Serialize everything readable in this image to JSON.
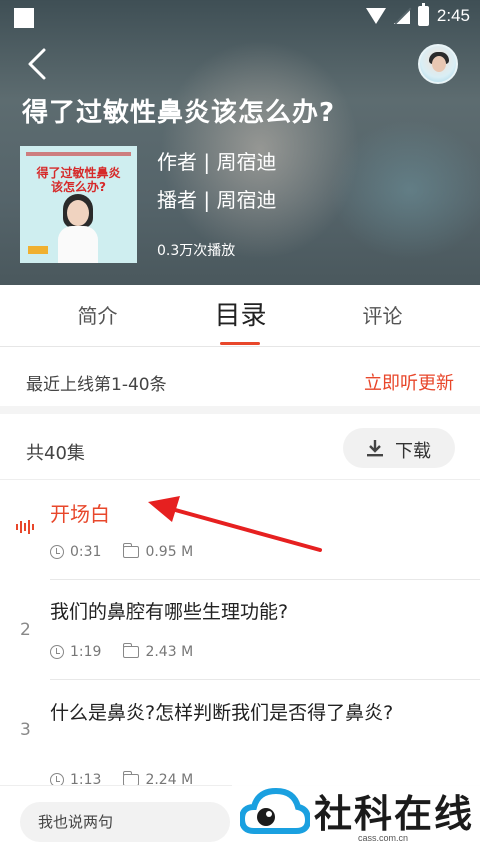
{
  "status_bar": {
    "time": "2:45"
  },
  "header": {
    "title": "得了过敏性鼻炎该怎么办?",
    "author": "作者 | 周宿迪",
    "reader": "播者 | 周宿迪",
    "plays": "0.3万次播放",
    "cover_title": [
      "得了过敏性鼻炎",
      "该怎么办?"
    ]
  },
  "tabs": [
    {
      "label": "简介",
      "active": false
    },
    {
      "label": "目录",
      "active": true
    },
    {
      "label": "评论",
      "active": false
    }
  ],
  "latest": {
    "text": "最近上线第1-40条",
    "action": "立即听更新"
  },
  "episodes_header": {
    "count": "共40集",
    "download_label": "下载"
  },
  "episodes": [
    {
      "number": "",
      "title": "开场白",
      "duration": "0:31",
      "size": "0.95 M",
      "playing": true
    },
    {
      "number": "2",
      "title": "我们的鼻腔有哪些生理功能?",
      "duration": "1:19",
      "size": "2.43 M",
      "playing": false
    },
    {
      "number": "3",
      "title": "什么是鼻炎?怎样判断我们是否得了鼻炎?",
      "duration": "1:13",
      "size": "2.24 M",
      "playing": false
    }
  ],
  "bottom_bar": {
    "comment_placeholder": "我也说两句"
  },
  "watermark": {
    "text": "社科在线",
    "sub": "cass.com.cn"
  },
  "colors": {
    "accent": "#e8472b",
    "header_bg": "#55646a"
  }
}
